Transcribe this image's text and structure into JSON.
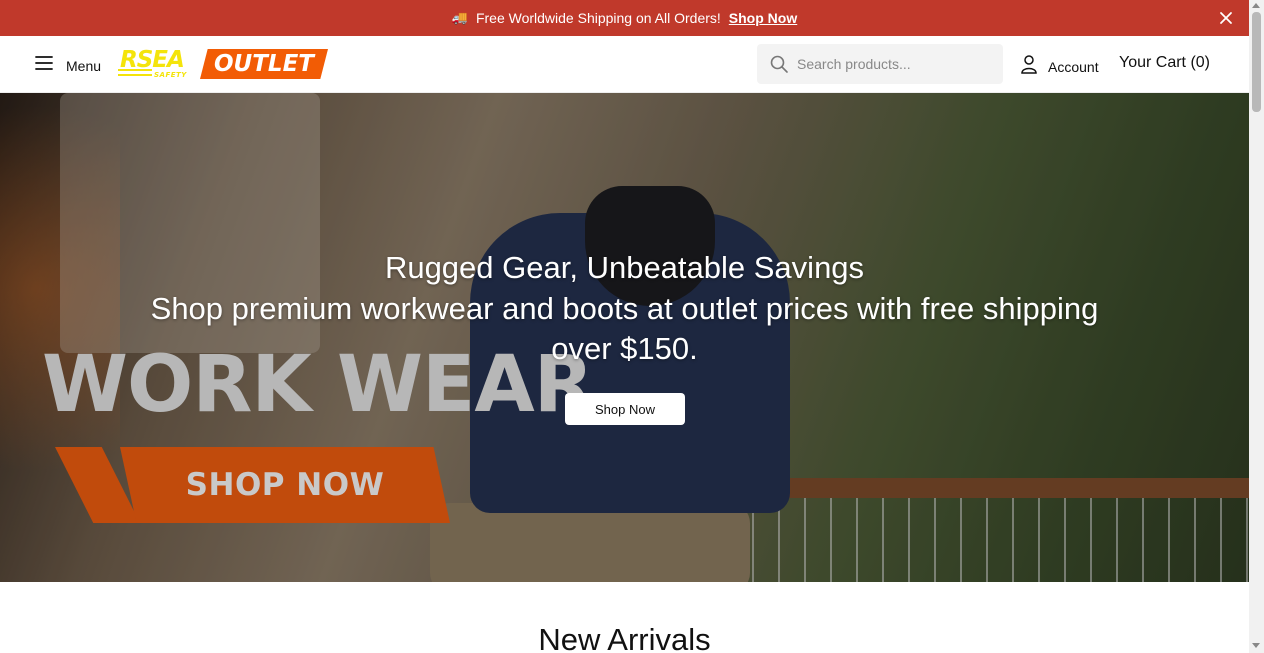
{
  "announcement": {
    "icon": "truck-icon",
    "message": "Free Worldwide Shipping on All Orders!",
    "link_label": "Shop Now"
  },
  "header": {
    "menu_label": "Menu",
    "logo": {
      "brand": "RSEA",
      "sub": "SAFETY",
      "outlet": "OUTLET"
    },
    "search_placeholder": "Search products...",
    "account_label": "Account",
    "cart_label": "Your Cart (0)"
  },
  "hero": {
    "image_text_work_wear": "WORK WEAR",
    "image_text_shop_now": "SHOP NOW",
    "title": "Rugged Gear, Unbeatable Savings",
    "subtitle": "Shop premium workwear and boots at outlet prices with free shipping over $150.",
    "button_label": "Shop Now"
  },
  "sections": {
    "new_arrivals_title": "New Arrivals"
  },
  "colors": {
    "announcement_bg": "#c0392b",
    "logo_yellow": "#f4e40b",
    "logo_orange": "#f25c05",
    "banner_orange": "#c14b0c"
  }
}
